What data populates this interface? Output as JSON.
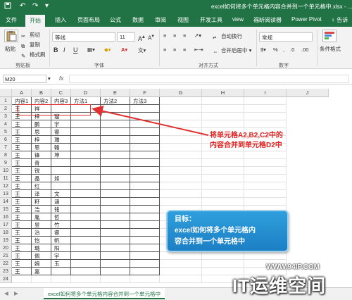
{
  "titlebar": {
    "title": "excel如何将多个单元格内容合并到一个单元格中.xlsx - ..."
  },
  "tabs": [
    "文件",
    "开始",
    "插入",
    "页面布局",
    "公式",
    "数据",
    "审阅",
    "视图",
    "开发工具",
    "view",
    "福昕阅读器",
    "Power Pivot",
    "♀ 告诉"
  ],
  "ribbon": {
    "cut": "剪切",
    "copy": "复制",
    "format_painter": "格式刷",
    "paste": "粘贴",
    "clipboard_label": "剪贴板",
    "font_name": "等线",
    "font_size": "11",
    "font_label": "字体",
    "wrap_text": "自动换行",
    "merge_center": "合并后居中",
    "align_label": "对齐方式",
    "number_format": "常规",
    "number_label": "数字",
    "conditional_format": "条件格式",
    "bold": "B",
    "italic": "I",
    "underline": "U"
  },
  "formula_bar": {
    "name_box": "M20",
    "fx": "fx"
  },
  "columns": [
    "A",
    "B",
    "C",
    "D",
    "E",
    "F",
    "G",
    "H",
    "I",
    "J"
  ],
  "rows": [
    [
      "内容1",
      "内容2",
      "内容3",
      "方法1",
      "方法2",
      "方法3"
    ],
    [
      "王",
      "祥",
      "",
      "",
      "",
      ""
    ],
    [
      "王",
      "梓",
      "璇",
      "",
      "",
      ""
    ],
    [
      "王",
      "鹏",
      "宇",
      "",
      "",
      ""
    ],
    [
      "王",
      "思",
      "睿",
      "",
      "",
      ""
    ],
    [
      "王",
      "梓",
      "瑞",
      "",
      "",
      ""
    ],
    [
      "王",
      "思",
      "翰",
      "",
      "",
      ""
    ],
    [
      "王",
      "锋",
      "坤",
      "",
      "",
      ""
    ],
    [
      "王",
      "青",
      "",
      "",
      "",
      ""
    ],
    [
      "王",
      "锐",
      "",
      "",
      "",
      ""
    ],
    [
      "王",
      "晶",
      "如",
      "",
      "",
      ""
    ],
    [
      "王",
      "红",
      "",
      "",
      "",
      ""
    ],
    [
      "王",
      "泽",
      "文",
      "",
      "",
      ""
    ],
    [
      "王",
      "籽",
      "涵",
      "",
      "",
      ""
    ],
    [
      "王",
      "浩",
      "铭",
      "",
      "",
      ""
    ],
    [
      "王",
      "胤",
      "哲",
      "",
      "",
      ""
    ],
    [
      "王",
      "昱",
      "竹",
      "",
      "",
      ""
    ],
    [
      "王",
      "治",
      "睿",
      "",
      "",
      ""
    ],
    [
      "王",
      "怡",
      "帆",
      "",
      "",
      ""
    ],
    [
      "王",
      "璐",
      "阳",
      "",
      "",
      ""
    ],
    [
      "王",
      "佩",
      "宇",
      "",
      "",
      ""
    ],
    [
      "王",
      "婉",
      "玉",
      "",
      "",
      ""
    ],
    [
      "王",
      "嘉",
      "",
      "",
      "",
      ""
    ],
    [
      "",
      "",
      "",
      "",
      "",
      ""
    ]
  ],
  "annotation": {
    "line1": "将单元格A2,B2,C2中的",
    "line2": "内容合并到单元格D2中"
  },
  "callout": {
    "line1": "目标：",
    "line2": "excel如何将多个单元格内",
    "line3": "容合并到一个单元格中"
  },
  "watermark": {
    "url": "WWW.94IP.COM",
    "brand": "IT运维空间"
  },
  "sheet_tab": "excel如何将多个单元格内容合并到一个单元格中",
  "colors": {
    "excel_green": "#217346",
    "annotation_red": "#e02020",
    "callout_blue": "#1c7fc4"
  }
}
